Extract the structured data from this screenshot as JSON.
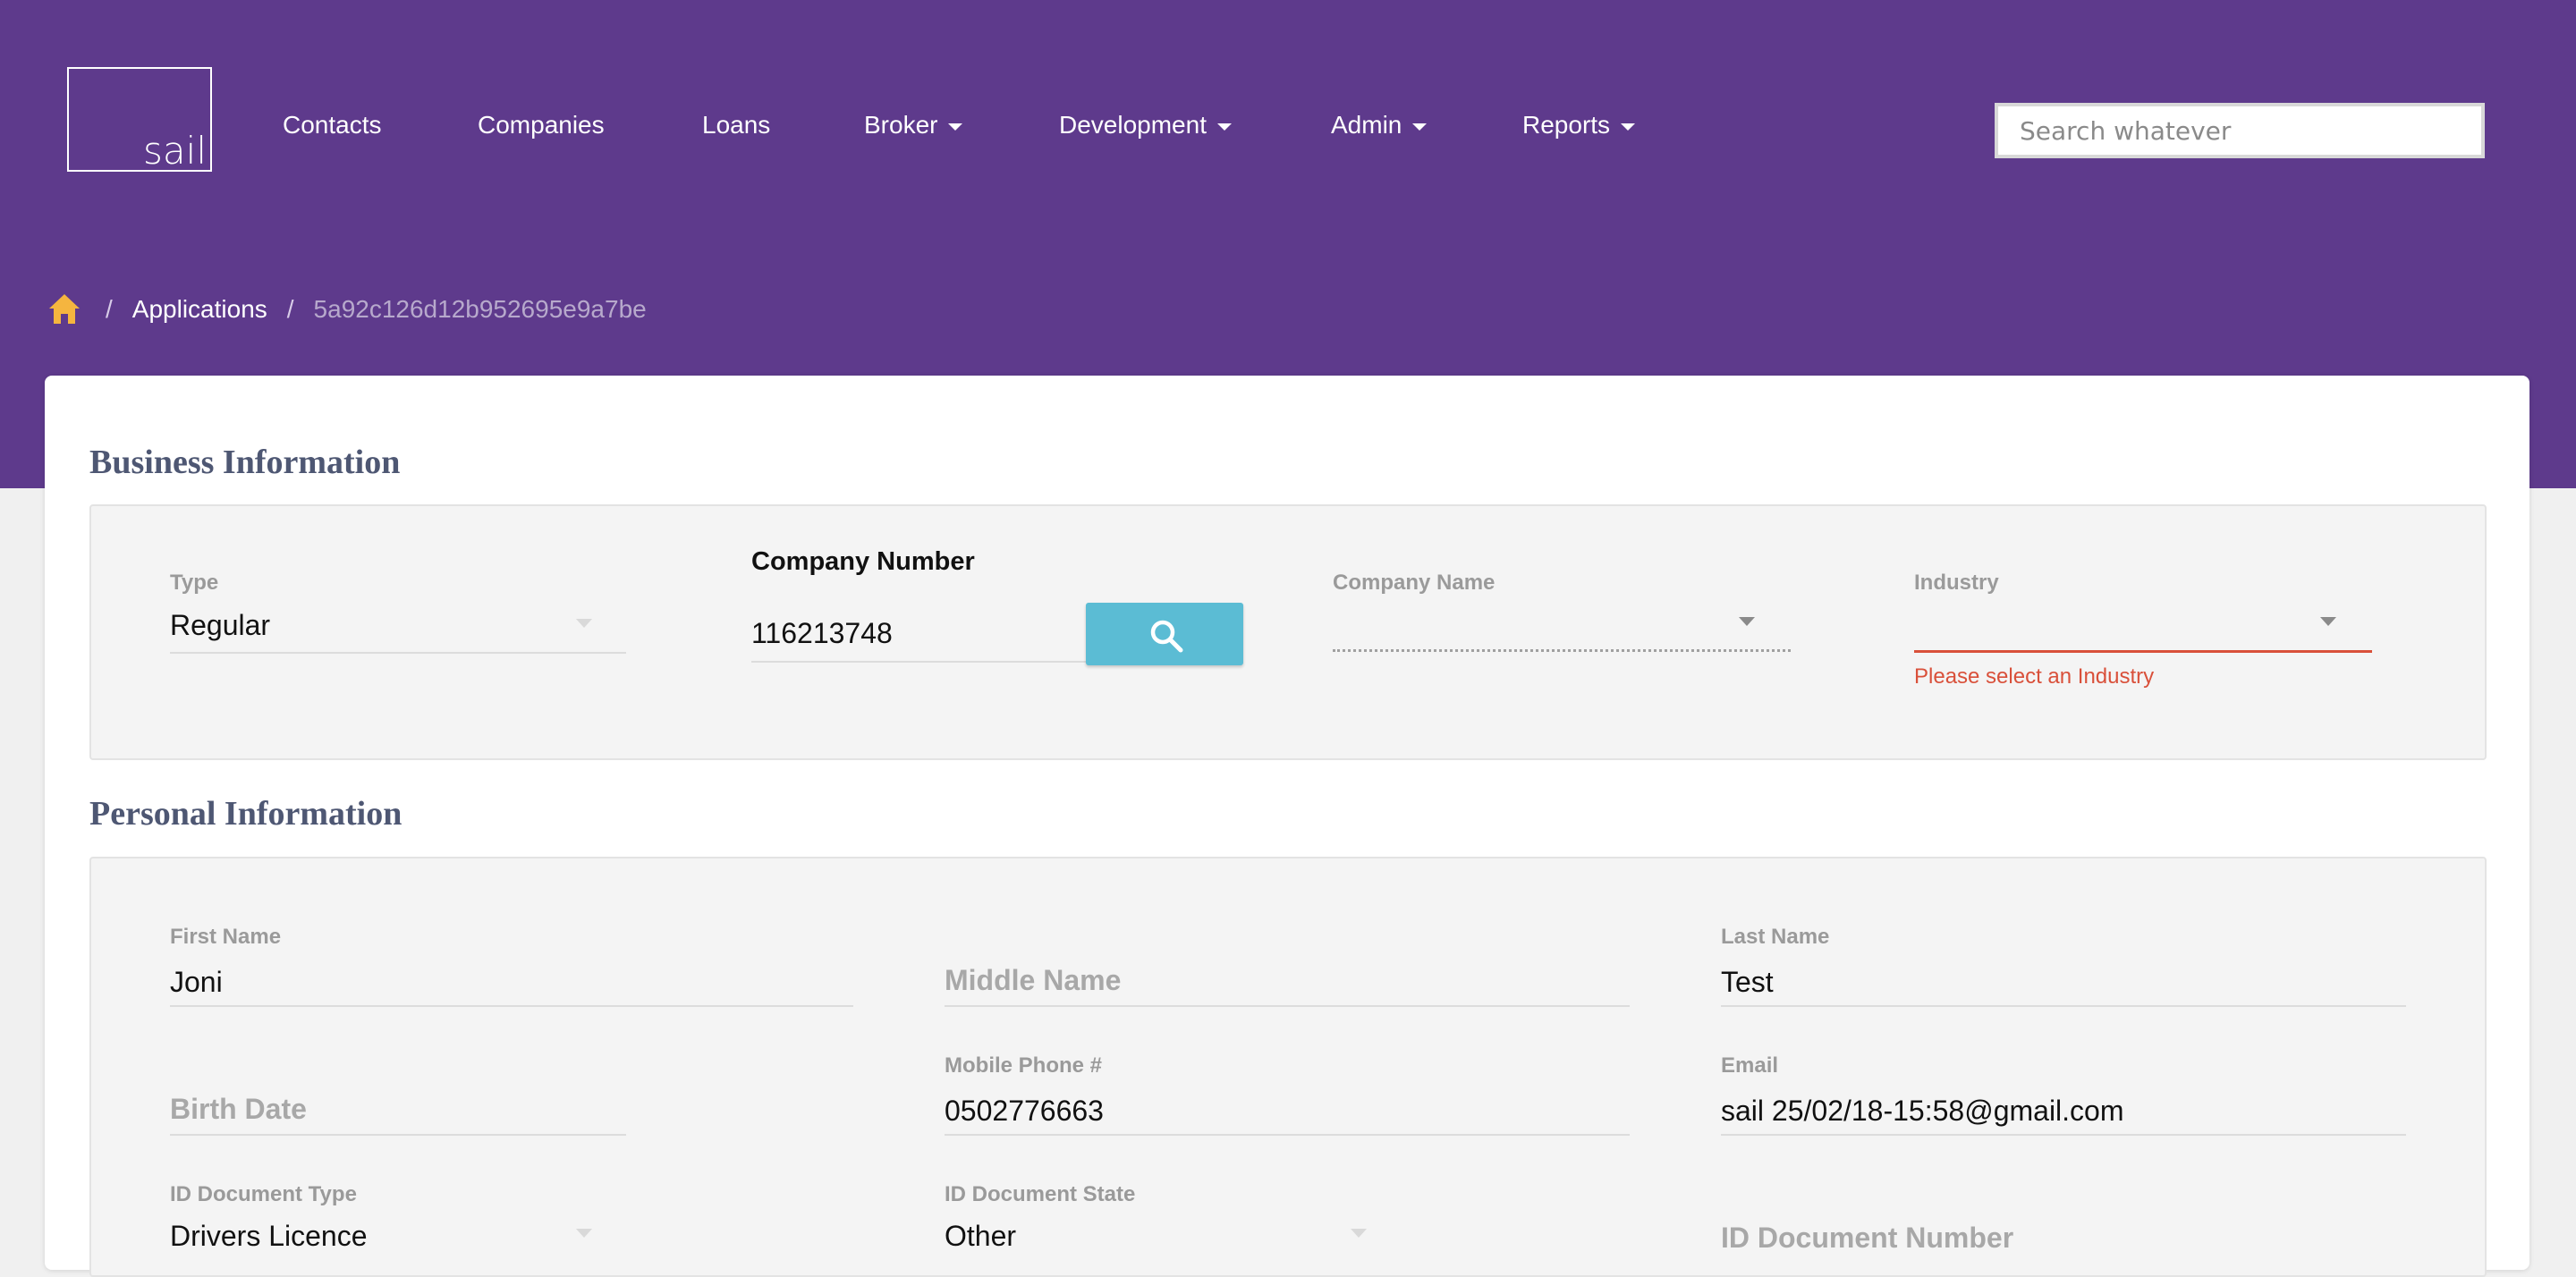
{
  "brand": {
    "logo_text": "sail"
  },
  "nav": {
    "items": [
      {
        "label": "Contacts"
      },
      {
        "label": "Companies"
      },
      {
        "label": "Loans"
      },
      {
        "label": "Broker"
      },
      {
        "label": "Development"
      },
      {
        "label": "Admin"
      },
      {
        "label": "Reports"
      }
    ],
    "search_placeholder": "Search whatever"
  },
  "breadcrumb": {
    "sep": "/",
    "items": [
      "Applications",
      "5a92c126d12b952695e9a7be"
    ]
  },
  "business": {
    "title": "Business Information",
    "type_label": "Type",
    "type_value": "Regular",
    "company_number_label": "Company Number",
    "company_number_value": "116213748",
    "company_name_label": "Company Name",
    "industry_label": "Industry",
    "industry_error": "Please select an Industry"
  },
  "personal": {
    "title": "Personal Information",
    "first_name_label": "First Name",
    "first_name_value": "Joni",
    "middle_name_placeholder": "Middle Name",
    "last_name_label": "Last Name",
    "last_name_value": "Test",
    "birth_date_placeholder": "Birth Date",
    "mobile_label": "Mobile Phone #",
    "mobile_value": "0502776663",
    "email_label": "Email",
    "email_value": "sail 25/02/18-15:58@gmail.com",
    "id_type_label": "ID Document Type",
    "id_type_value": "Drivers Licence",
    "id_state_label": "ID Document State",
    "id_state_value": "Other",
    "id_number_placeholder": "ID Document Number"
  },
  "colors": {
    "header": "#5e3a8c",
    "accent": "#5bbcd4",
    "error": "#d9503a",
    "home_icon": "#f5b53f"
  }
}
